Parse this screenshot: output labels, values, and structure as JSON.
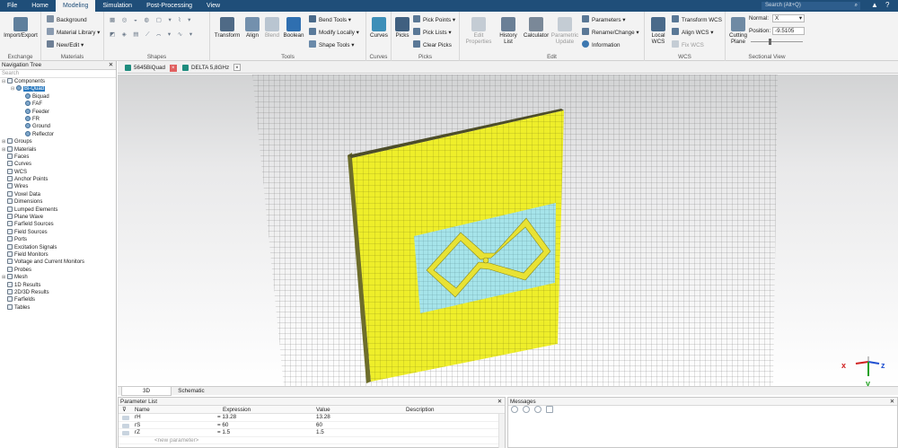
{
  "menu": {
    "tabs": [
      "File",
      "Home",
      "Modeling",
      "Simulation",
      "Post-Processing",
      "View"
    ],
    "active_tab": "Modeling",
    "search_placeholder": "Search (Alt+Q)"
  },
  "ribbon": {
    "groups": {
      "exchange": "Exchange",
      "materials": "Materials",
      "shapes": "Shapes",
      "tools": "Tools",
      "curves": "Curves",
      "picks": "Picks",
      "edit": "Edit",
      "wcs": "WCS",
      "sectional_view": "Sectional View"
    },
    "import_export": "Import/Export",
    "background": "Background",
    "material_library": "Material Library",
    "new_edit": "New/Edit",
    "transform": "Transform",
    "align": "Align",
    "blend": "Blend",
    "boolean": "Boolean",
    "bend_tools": "Bend Tools",
    "modify_locally": "Modify Locally",
    "shape_tools": "Shape Tools",
    "curves": "Curves",
    "picks": "Picks",
    "pick_points": "Pick Points",
    "pick_lists": "Pick Lists",
    "clear_picks": "Clear Picks",
    "edit_properties": "Edit Properties",
    "history_list": "History List",
    "calculator": "Calculator",
    "parametric_update": "Parametric Update",
    "parameters": "Parameters",
    "rename_change": "Rename/Change",
    "information": "Information",
    "local_wcs": "Local WCS",
    "transform_wcs": "Transform WCS",
    "align_wcs": "Align WCS",
    "fix_wcs": "Fix WCS",
    "cutting_plane": "Cutting Plane",
    "normal_label": "Normal:",
    "normal_value": "X",
    "position_label": "Position:",
    "position_value": "-9.5105"
  },
  "navigation": {
    "title": "Navigation Tree",
    "search_placeholder": "Search",
    "items": [
      {
        "label": "Components",
        "depth": 0,
        "expander": "⊟"
      },
      {
        "label": "Bi-Quad",
        "depth": 1,
        "expander": "⊟",
        "selected": true
      },
      {
        "label": "Biquad",
        "depth": 2,
        "expander": ""
      },
      {
        "label": "FAF",
        "depth": 2,
        "expander": ""
      },
      {
        "label": "Feeder",
        "depth": 2,
        "expander": ""
      },
      {
        "label": "FR",
        "depth": 2,
        "expander": ""
      },
      {
        "label": "Ground",
        "depth": 2,
        "expander": ""
      },
      {
        "label": "Reflector",
        "depth": 2,
        "expander": ""
      },
      {
        "label": "Groups",
        "depth": 0,
        "expander": "⊞"
      },
      {
        "label": "Materials",
        "depth": 0,
        "expander": "⊞"
      },
      {
        "label": "Faces",
        "depth": 0,
        "expander": ""
      },
      {
        "label": "Curves",
        "depth": 0,
        "expander": ""
      },
      {
        "label": "WCS",
        "depth": 0,
        "expander": ""
      },
      {
        "label": "Anchor Points",
        "depth": 0,
        "expander": ""
      },
      {
        "label": "Wires",
        "depth": 0,
        "expander": ""
      },
      {
        "label": "Voxel Data",
        "depth": 0,
        "expander": ""
      },
      {
        "label": "Dimensions",
        "depth": 0,
        "expander": ""
      },
      {
        "label": "Lumped Elements",
        "depth": 0,
        "expander": ""
      },
      {
        "label": "Plane Wave",
        "depth": 0,
        "expander": ""
      },
      {
        "label": "Farfield Sources",
        "depth": 0,
        "expander": ""
      },
      {
        "label": "Field Sources",
        "depth": 0,
        "expander": ""
      },
      {
        "label": "Ports",
        "depth": 0,
        "expander": ""
      },
      {
        "label": "Excitation Signals",
        "depth": 0,
        "expander": ""
      },
      {
        "label": "Field Monitors",
        "depth": 0,
        "expander": ""
      },
      {
        "label": "Voltage and Current Monitors",
        "depth": 0,
        "expander": ""
      },
      {
        "label": "Probes",
        "depth": 0,
        "expander": ""
      },
      {
        "label": "Mesh",
        "depth": 0,
        "expander": "⊞"
      },
      {
        "label": "1D Results",
        "depth": 0,
        "expander": ""
      },
      {
        "label": "2D/3D Results",
        "depth": 0,
        "expander": ""
      },
      {
        "label": "Farfields",
        "depth": 0,
        "expander": ""
      },
      {
        "label": "Tables",
        "depth": 0,
        "expander": ""
      }
    ]
  },
  "doc_tabs": [
    {
      "label": "5645BiQuad",
      "close": "×"
    },
    {
      "label": "DELTA 5,8GHz",
      "close": "×"
    }
  ],
  "view_tabs": [
    "3D",
    "Schematic"
  ],
  "axes": {
    "x": "x",
    "y": "y",
    "z": "z"
  },
  "parameters": {
    "title": "Parameter List",
    "columns": [
      "Name",
      "Expression",
      "Value",
      "Description"
    ],
    "rows": [
      {
        "name": "rH",
        "expression": "= 13.28",
        "value": "13.28"
      },
      {
        "name": "rS",
        "expression": "= 60",
        "value": "60"
      },
      {
        "name": "rZ",
        "expression": "= 1.5",
        "value": "1.5"
      }
    ],
    "new_placeholder": "<new parameter>"
  },
  "messages": {
    "title": "Messages"
  },
  "colors": {
    "menubar": "#1f4e79",
    "board": "#eeee2a",
    "cutout": "#a6e4ea"
  }
}
